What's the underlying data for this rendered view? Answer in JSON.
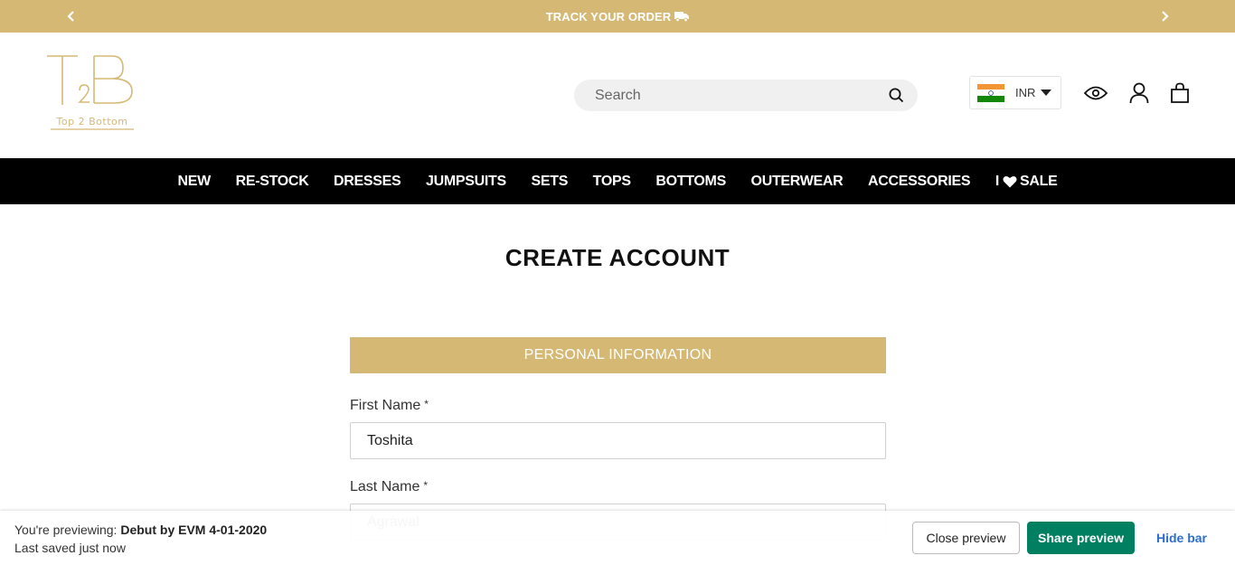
{
  "announcement": {
    "text": "TRACK YOUR ORDER",
    "prev_icon": "chevron-left-icon",
    "next_icon": "chevron-right-icon",
    "truck_icon": "truck-icon"
  },
  "header": {
    "logo": {
      "monogram": "T2B",
      "tagline": "Top 2 Bottom"
    },
    "search": {
      "placeholder": "Search"
    },
    "currency": {
      "code": "INR"
    }
  },
  "nav": {
    "items": [
      "NEW",
      "RE-STOCK",
      "DRESSES",
      "JUMPSUITS",
      "SETS",
      "TOPS",
      "BOTTOMS",
      "OUTERWEAR",
      "ACCESSORIES"
    ],
    "sale": {
      "prefix": "I",
      "suffix": "SALE"
    }
  },
  "main": {
    "title": "CREATE ACCOUNT",
    "section_title": "PERSONAL INFORMATION",
    "fields": [
      {
        "label": "First Name",
        "required_mark": "*",
        "value": "Toshita"
      },
      {
        "label": "Last Name",
        "required_mark": "*",
        "value": "Agrawal"
      }
    ]
  },
  "preview_bar": {
    "previewing_prefix": "You're previewing:",
    "theme_name": "Debut by EVM 4-01-2020",
    "saved_text": "Last saved just now",
    "close_label": "Close preview",
    "share_label": "Share preview",
    "hide_label": "Hide bar"
  },
  "colors": {
    "gold": "#d5b874",
    "nav_bg": "#000000",
    "share_green": "#008060",
    "link_blue": "#2c6ecb"
  }
}
